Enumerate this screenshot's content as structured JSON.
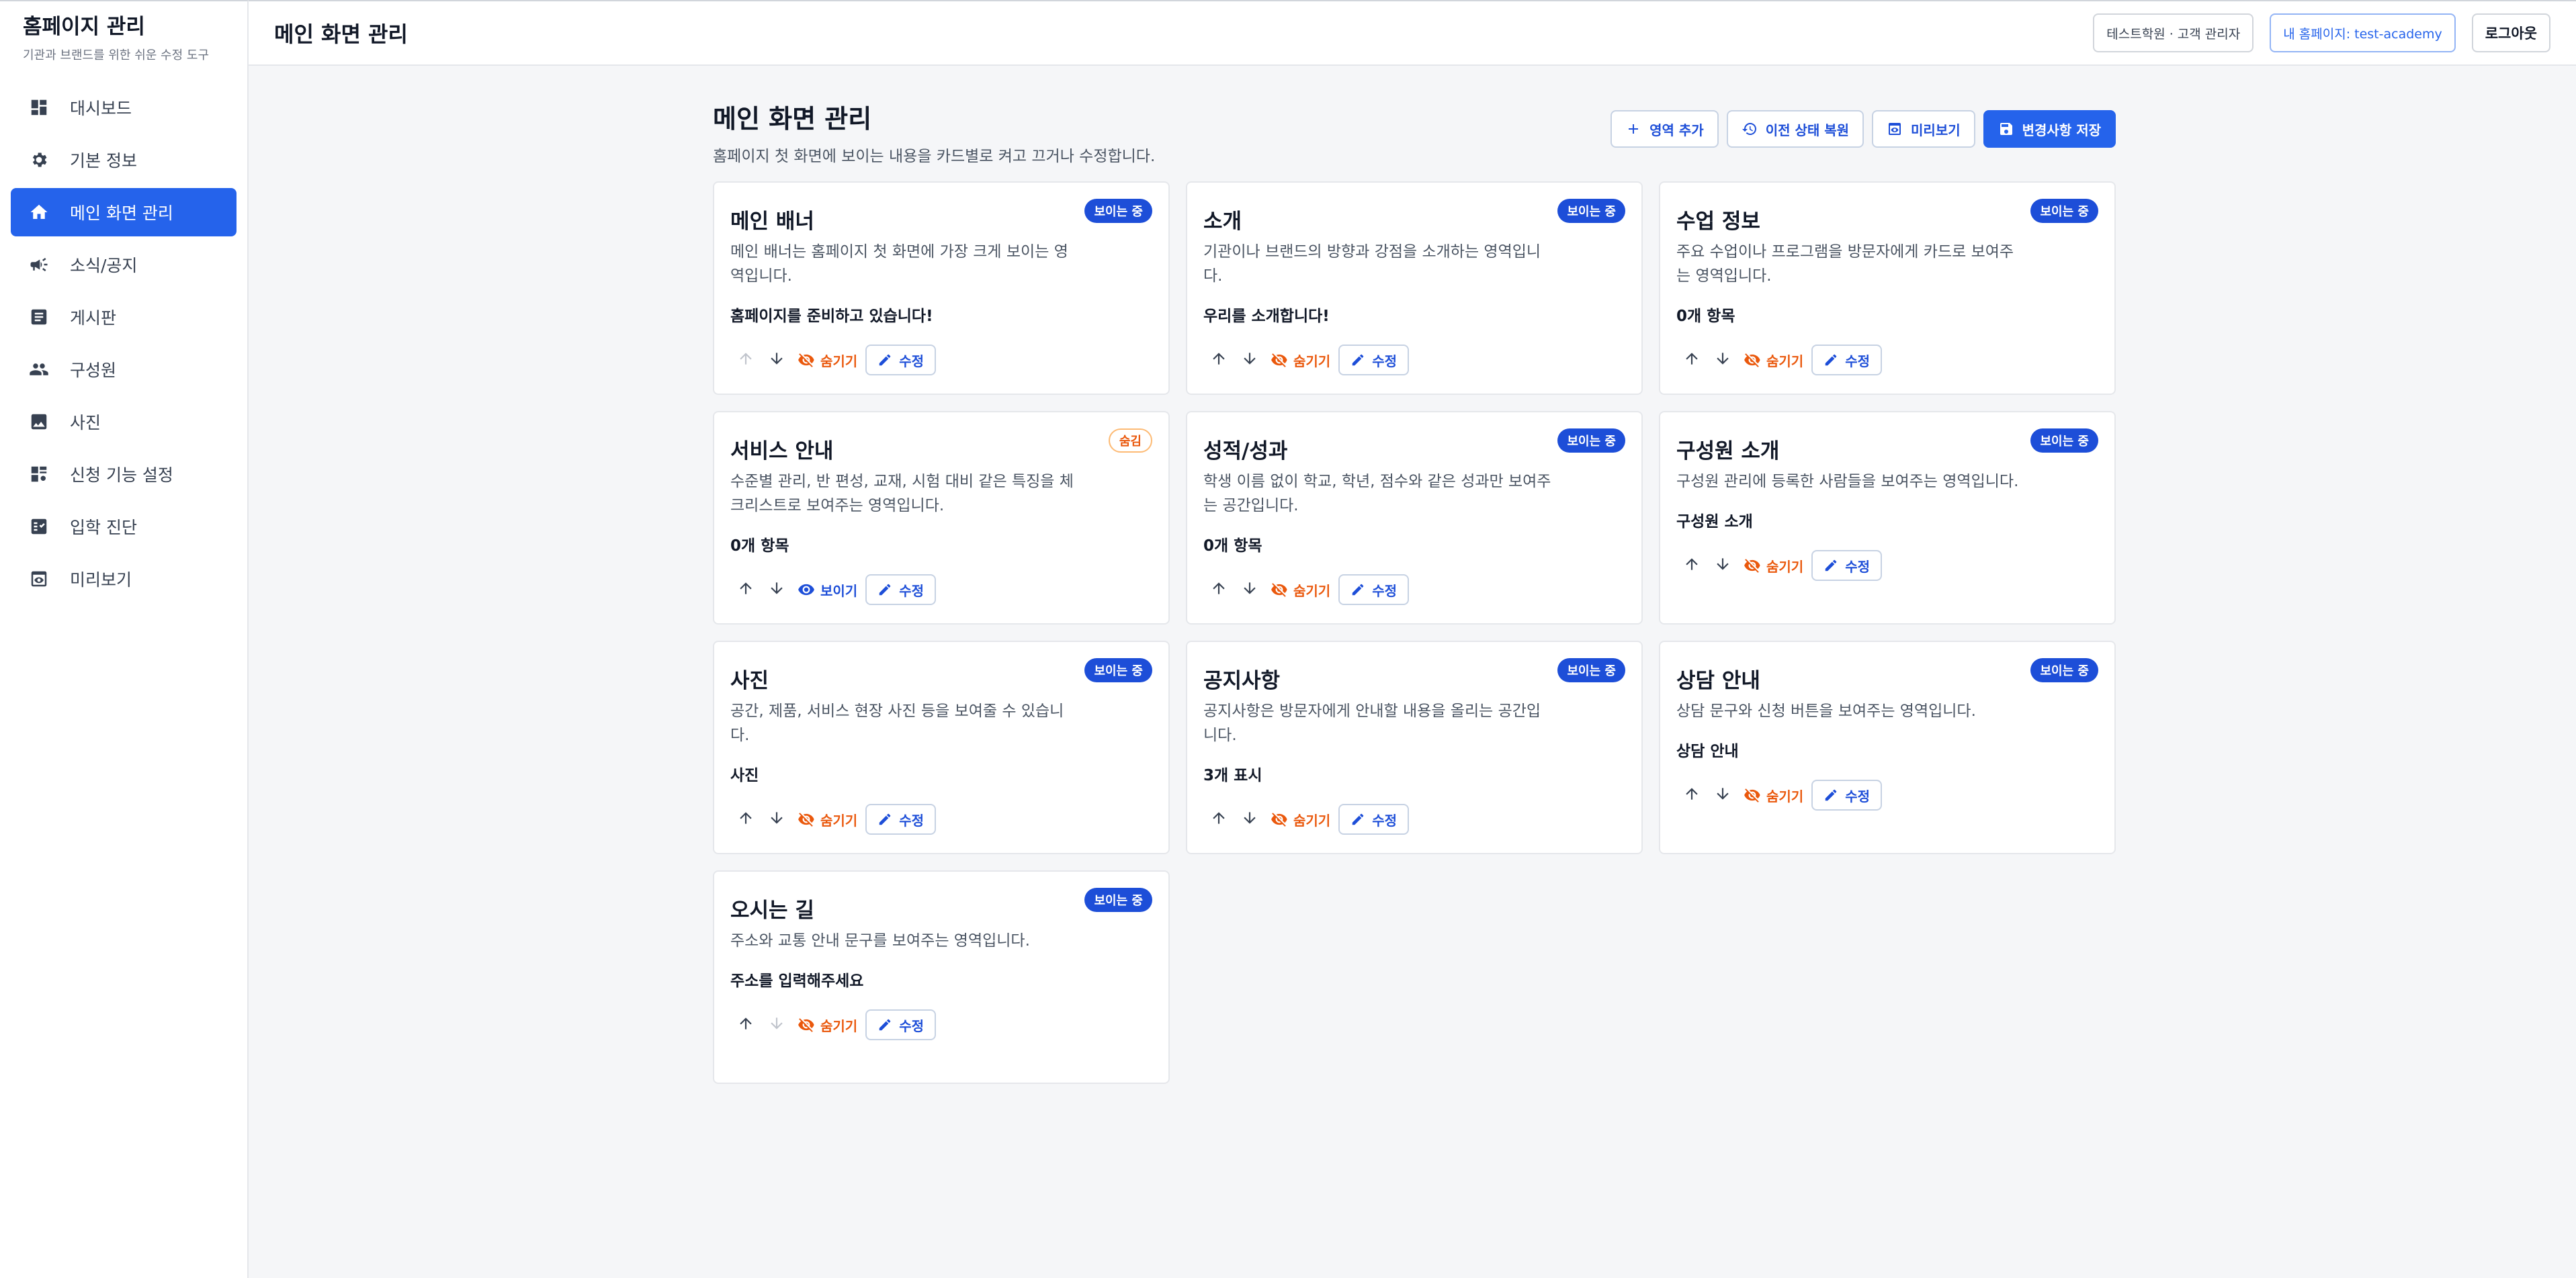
{
  "sidebar": {
    "title": "홈페이지 관리",
    "subtitle": "기관과 브랜드를 위한 쉬운 수정 도구",
    "items": [
      {
        "label": "대시보드",
        "icon": "dashboard-icon"
      },
      {
        "label": "기본 정보",
        "icon": "gear-icon"
      },
      {
        "label": "메인 화면 관리",
        "icon": "home-icon",
        "active": true
      },
      {
        "label": "소식/공지",
        "icon": "megaphone-icon"
      },
      {
        "label": "게시판",
        "icon": "article-icon"
      },
      {
        "label": "구성원",
        "icon": "people-icon"
      },
      {
        "label": "사진",
        "icon": "image-icon"
      },
      {
        "label": "신청 기능 설정",
        "icon": "form-settings-icon"
      },
      {
        "label": "입학 진단",
        "icon": "checklist-icon"
      },
      {
        "label": "미리보기",
        "icon": "preview-icon"
      }
    ]
  },
  "topbar": {
    "title": "메인 화면 관리",
    "account": "테스트학원 · 고객 관리자",
    "site_link": "내 홈페이지: test-academy",
    "logout": "로그아웃"
  },
  "main": {
    "title": "메인 화면 관리",
    "description": "홈페이지 첫 화면에 보이는 내용을 카드별로 켜고 끄거나 수정합니다.",
    "actions": {
      "add": "영역 추가",
      "restore": "이전 상태 복원",
      "preview": "미리보기",
      "save": "변경사항 저장"
    }
  },
  "labels": {
    "badge_visible": "보이는 중",
    "badge_hidden": "숨김",
    "hide": "숨기기",
    "show": "보이기",
    "edit": "수정"
  },
  "colors": {
    "accent": "#2563eb",
    "hidden": "#ea580c"
  },
  "cards": [
    {
      "title": "메인 배너",
      "description": "메인 배너는 홈페이지 첫 화면에 가장 크게 보이는 영역입니다.",
      "summary": "홈페이지를 준비하고 있습니다!",
      "visible": true,
      "up_disabled": true,
      "down_disabled": false
    },
    {
      "title": "소개",
      "description": "기관이나 브랜드의 방향과 강점을 소개하는 영역입니다.",
      "summary": "우리를 소개합니다!",
      "visible": true,
      "up_disabled": false,
      "down_disabled": false
    },
    {
      "title": "수업 정보",
      "description": "주요 수업이나 프로그램을 방문자에게 카드로 보여주는 영역입니다.",
      "summary": "0개 항목",
      "visible": true,
      "up_disabled": false,
      "down_disabled": false
    },
    {
      "title": "서비스 안내",
      "description": "수준별 관리, 반 편성, 교재, 시험 대비 같은 특징을 체크리스트로 보여주는 영역입니다.",
      "summary": "0개 항목",
      "visible": false,
      "up_disabled": false,
      "down_disabled": false
    },
    {
      "title": "성적/성과",
      "description": "학생 이름 없이 학교, 학년, 점수와 같은 성과만 보여주는 공간입니다.",
      "summary": "0개 항목",
      "visible": true,
      "up_disabled": false,
      "down_disabled": false
    },
    {
      "title": "구성원 소개",
      "description": "구성원 관리에 등록한 사람들을 보여주는 영역입니다.",
      "summary": "구성원 소개",
      "visible": true,
      "up_disabled": false,
      "down_disabled": false
    },
    {
      "title": "사진",
      "description": "공간, 제품, 서비스 현장 사진 등을 보여줄 수 있습니다.",
      "summary": "사진",
      "visible": true,
      "up_disabled": false,
      "down_disabled": false
    },
    {
      "title": "공지사항",
      "description": "공지사항은 방문자에게 안내할 내용을 올리는 공간입니다.",
      "summary": "3개 표시",
      "visible": true,
      "up_disabled": false,
      "down_disabled": false
    },
    {
      "title": "상담 안내",
      "description": "상담 문구와 신청 버튼을 보여주는 영역입니다.",
      "summary": "상담 안내",
      "visible": true,
      "up_disabled": false,
      "down_disabled": false
    },
    {
      "title": "오시는 길",
      "description": "주소와 교통 안내 문구를 보여주는 영역입니다.",
      "summary": "주소를 입력해주세요",
      "visible": true,
      "up_disabled": false,
      "down_disabled": true
    }
  ]
}
